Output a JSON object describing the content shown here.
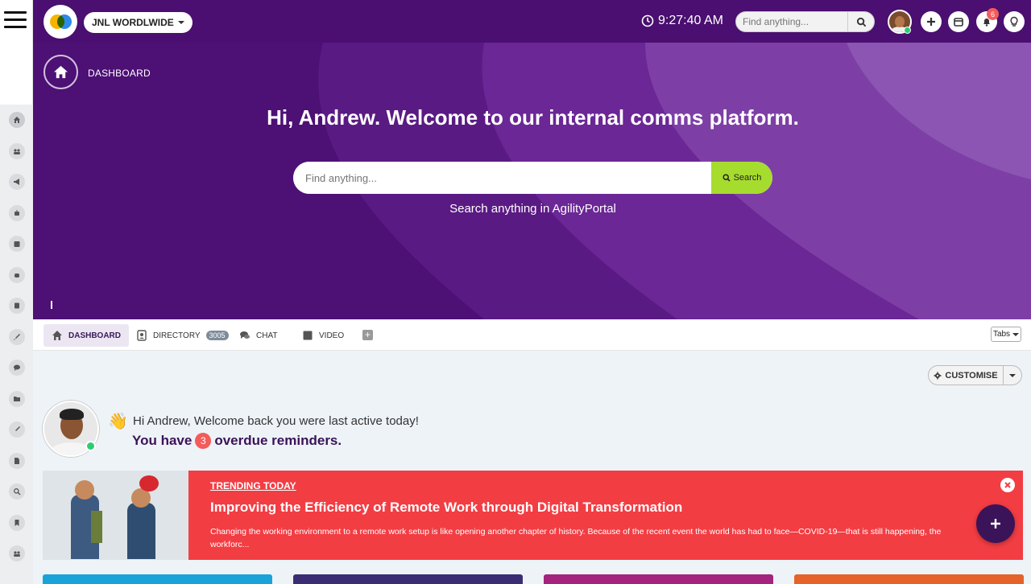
{
  "topbar": {
    "org_name": "JNL WORDLWIDE",
    "time": "9:27:40 AM",
    "search_placeholder": "Find anything...",
    "notification_count": "6"
  },
  "hero": {
    "breadcrumb": "DASHBOARD",
    "title": "Hi, Andrew. Welcome to our internal comms platform.",
    "search_placeholder": "Find anything...",
    "search_button": "Search",
    "subtitle": "Search anything in AgilityPortal"
  },
  "tabs": {
    "items": [
      {
        "label": "DASHBOARD",
        "icon": "home-icon"
      },
      {
        "label": "DIRECTORY",
        "icon": "contacts-icon",
        "badge": "3005"
      },
      {
        "label": "CHAT",
        "icon": "chat-icon"
      },
      {
        "label": "VIDEO",
        "icon": "video-icon"
      }
    ],
    "selector_label": "Tabs"
  },
  "main": {
    "customise_label": "CUSTOMISE",
    "wave": "👋",
    "welcome_text": "Hi Andrew, Welcome back you were last active today!",
    "reminders_prefix": "You have",
    "reminders_count": "3",
    "reminders_suffix": "overdue reminders."
  },
  "trending": {
    "tag": "TRENDING TODAY",
    "title": "Improving the Efficiency of Remote Work through Digital Transformation",
    "description": "Changing the working environment to a remote work setup is like opening another chapter of history. Because of the recent event the world has had to face—COVID-19—that is still happening, the workforc..."
  },
  "colors": {
    "brand_purple": "#4a0f70",
    "accent_green": "#a6dc2e",
    "trending_red": "#f23d43",
    "fab_purple": "#3b1358",
    "card_colors": [
      "#1aa3d9",
      "#3a2d73",
      "#a3237e",
      "#e5622a"
    ]
  },
  "sidebar": {
    "icons": [
      "home-icon",
      "users-icon",
      "megaphone-icon",
      "robot-icon",
      "calendar-icon",
      "robot-icon",
      "note-icon",
      "rocket-icon",
      "chat-icon",
      "folder-icon",
      "rocket-icon",
      "document-icon",
      "search-icon",
      "bookmark-icon",
      "group-icon"
    ]
  }
}
